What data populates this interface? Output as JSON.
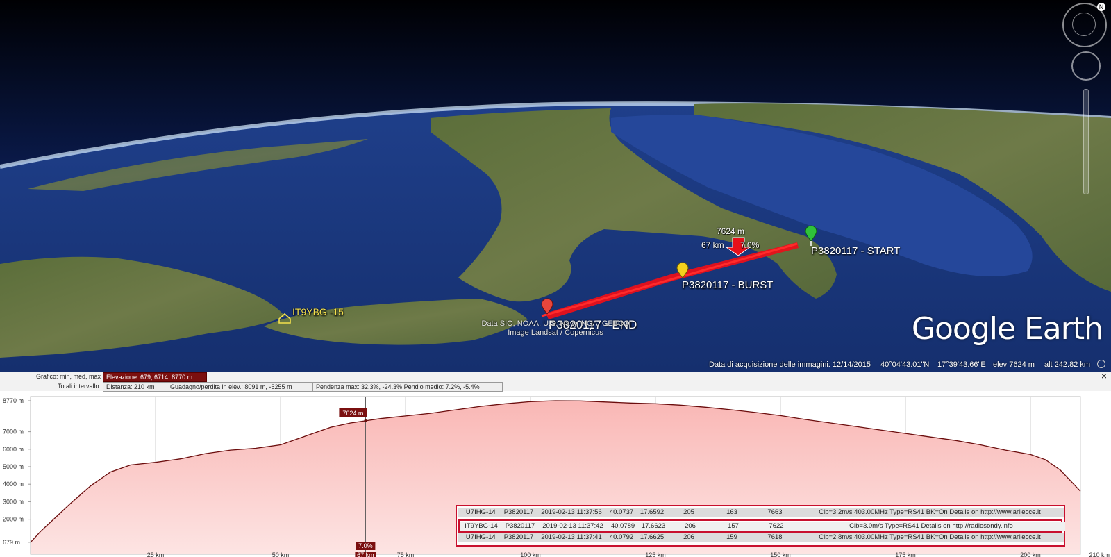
{
  "map": {
    "marker_start": "P3820117 - START",
    "marker_burst": "P3820117 - BURST",
    "marker_end": "P3820117 - END",
    "station": "IT9YBG -15",
    "cursor_elev": "7624 m",
    "cursor_dist": "67 km",
    "cursor_grade": "7.0%",
    "attribution_line1": "Data SIO, NOAA, U.S. Navy, NGA, GEBCO",
    "attribution_line2": "Image Landsat / Copernicus",
    "logo": "Google Earth",
    "colors": {
      "track": "#e8101a",
      "start_pin": "#2fc23a",
      "burst_pin": "#f3d11c",
      "end_pin": "#e8463c",
      "station_label": "#f4e04d"
    }
  },
  "statusbar": {
    "imagery_date": "Data di acquisizione delle immagini: 12/14/2015",
    "lat": "40°04'43.01\"N",
    "lon": "17°39'43.66\"E",
    "elev": "elev  7624 m",
    "alt": "alt 242.82 km"
  },
  "panel": {
    "row1_label": "Grafico: min, med, max",
    "row1_value": "Elevazione: 679, 6714, 8770 m",
    "row2_label": "Totali intervallo:",
    "row2_distance": "Distanza: 210 km",
    "row2_gain": "Guadagno/perdita in elev.: 8091 m, -5255 m",
    "row2_slope": "Pendenza max: 32.3%, -24.3% Pendio medio: 7.2%, -5.4%",
    "close": "×"
  },
  "chart_data": {
    "type": "area",
    "title": "",
    "xlabel": "",
    "ylabel": "",
    "x_unit": "km",
    "y_unit": "m",
    "xlim": [
      0,
      210
    ],
    "y_ticks": [
      679,
      2000,
      3000,
      4000,
      5000,
      6000,
      7000,
      8770
    ],
    "y_tick_labels": [
      "679 m",
      "2000 m",
      "3000 m",
      "4000 m",
      "5000 m",
      "6000 m",
      "7000 m",
      "8770 m"
    ],
    "x_ticks": [
      25,
      50,
      67,
      75,
      100,
      125,
      150,
      175,
      200,
      210
    ],
    "x_tick_labels": [
      "25 km",
      "50 km",
      "67 km",
      "75 km",
      "100 km",
      "125 km",
      "150 km",
      "175 km",
      "200 km",
      "210 km"
    ],
    "x": [
      0,
      2,
      5,
      8,
      12,
      16,
      20,
      25,
      30,
      35,
      40,
      45,
      50,
      55,
      60,
      64,
      67,
      70,
      75,
      80,
      85,
      90,
      95,
      100,
      105,
      110,
      115,
      120,
      125,
      130,
      135,
      140,
      145,
      150,
      155,
      160,
      165,
      170,
      175,
      180,
      185,
      190,
      195,
      200,
      203,
      206,
      208,
      210
    ],
    "y": [
      679,
      1300,
      2100,
      2900,
      3900,
      4700,
      5100,
      5250,
      5450,
      5750,
      5950,
      6050,
      6250,
      6750,
      7250,
      7500,
      7624,
      7750,
      7900,
      8050,
      8250,
      8450,
      8600,
      8720,
      8770,
      8760,
      8700,
      8640,
      8600,
      8520,
      8400,
      8260,
      8100,
      7920,
      7700,
      7500,
      7300,
      7100,
      6900,
      6700,
      6500,
      6250,
      5950,
      5700,
      5400,
      4800,
      4200,
      3600
    ],
    "cursor": {
      "x": 67,
      "y": 7624,
      "label": "7624 m",
      "grade": "7.0%",
      "x_label": "67 km"
    },
    "colors": {
      "line": "#6b0d0d",
      "fill_top": "#f9b7b5",
      "fill_bottom": "#fde4e3",
      "grid": "#cfcfcf",
      "cursor_box": "#7a0f0f"
    }
  },
  "table": {
    "rows": [
      {
        "call": "IU7IHG-14",
        "id": "P3820117",
        "time": "2019-02-13 11:37:56",
        "lat": "40.0737",
        "lon": "17.6592",
        "c1": "205",
        "c2": "163",
        "alt": "7663",
        "comment": "Clb=3.2m/s 403.00MHz Type=RS41 BK=On Details on http://www.arilecce.it"
      },
      {
        "call": "IT9YBG-14",
        "id": "P3820117",
        "time": "2019-02-13 11:37:42",
        "lat": "40.0789",
        "lon": "17.6623",
        "c1": "206",
        "c2": "157",
        "alt": "7622",
        "comment": "Clb=3.0m/s Type=RS41 Details on http://radiosondy.info"
      },
      {
        "call": "IU7IHG-14",
        "id": "P3820117",
        "time": "2019-02-13 11:37:41",
        "lat": "40.0792",
        "lon": "17.6625",
        "c1": "206",
        "c2": "159",
        "alt": "7618",
        "comment": "Clb=2.8m/s 403.00MHz Type=RS41 BK=On Details on http://www.arilecce.it"
      }
    ]
  }
}
